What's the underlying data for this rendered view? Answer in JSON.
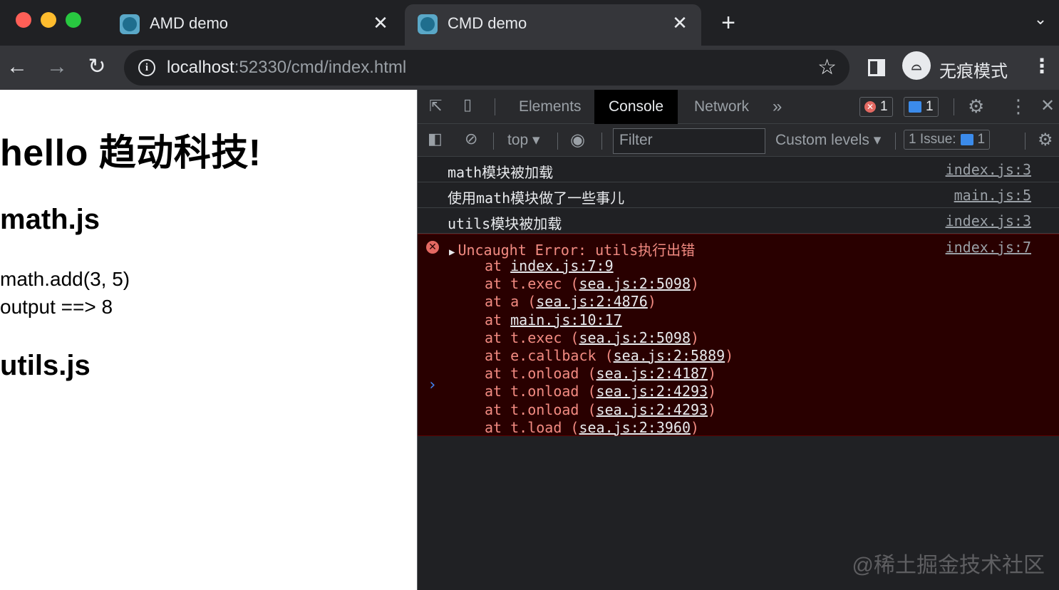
{
  "window": {
    "traffic_colors": [
      "#ff5f57",
      "#febc2e",
      "#28c840"
    ]
  },
  "tabs": [
    {
      "title": "AMD demo",
      "active": false
    },
    {
      "title": "CMD demo",
      "active": true
    }
  ],
  "toolbar": {
    "url_host": "localhost",
    "url_rest": ":52330/cmd/index.html",
    "profile_label": "无痕模式"
  },
  "page": {
    "h1": "hello 趋动科技!",
    "h2_math": "math.js",
    "math_line1": "math.add(3, 5)",
    "math_line2": "output ==> 8",
    "h2_utils": "utils.js"
  },
  "devtools": {
    "tabs": [
      "Elements",
      "Console",
      "Network"
    ],
    "active_tab": "Console",
    "more_tabs": "»",
    "error_count": "1",
    "message_count": "1",
    "context": "top",
    "filter_placeholder": "Filter",
    "levels": "Custom levels",
    "issues_label": "1 Issue:",
    "issues_count": "1"
  },
  "console": {
    "messages": [
      {
        "text": "math模块被加载",
        "source": "index.js:3"
      },
      {
        "text": "使用math模块做了一些事儿",
        "source": "main.js:5"
      },
      {
        "text": "utils模块被加载",
        "source": "index.js:3"
      }
    ],
    "error": {
      "text": "Uncaught Error: utils执行出错",
      "source": "index.js:7",
      "stack": [
        {
          "prefix": "at ",
          "fn": "",
          "loc": "index.js:7:9"
        },
        {
          "prefix": "at ",
          "fn": "t.exec",
          "loc": "sea.js:2:5098"
        },
        {
          "prefix": "at ",
          "fn": "a",
          "loc": "sea.js:2:4876"
        },
        {
          "prefix": "at ",
          "fn": "",
          "loc": "main.js:10:17"
        },
        {
          "prefix": "at ",
          "fn": "t.exec",
          "loc": "sea.js:2:5098"
        },
        {
          "prefix": "at ",
          "fn": "e.callback",
          "loc": "sea.js:2:5889"
        },
        {
          "prefix": "at ",
          "fn": "t.onload",
          "loc": "sea.js:2:4187"
        },
        {
          "prefix": "at ",
          "fn": "t.onload",
          "loc": "sea.js:2:4293"
        },
        {
          "prefix": "at ",
          "fn": "t.onload",
          "loc": "sea.js:2:4293"
        },
        {
          "prefix": "at ",
          "fn": "t.load",
          "loc": "sea.js:2:3960"
        }
      ]
    },
    "prompt": "›"
  },
  "watermark": "@稀土掘金技术社区"
}
